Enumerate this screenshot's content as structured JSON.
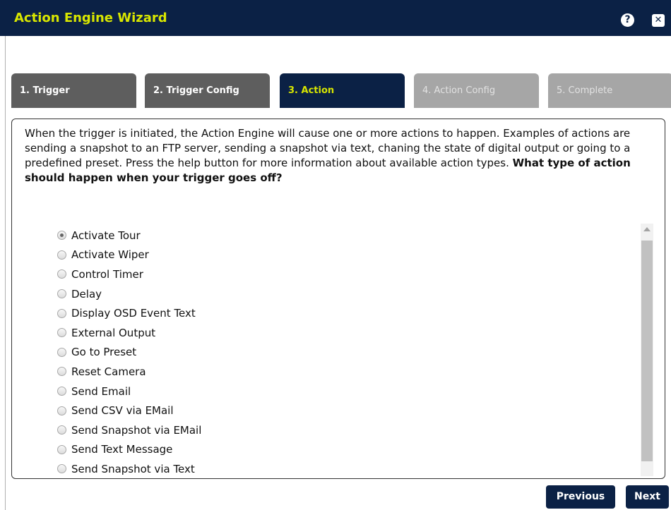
{
  "window": {
    "title": "Action Engine Wizard",
    "help_icon_glyph": "?",
    "close_icon_glyph": "✕",
    "colors": {
      "header_bg": "#0b2145",
      "title_text": "#d8e600",
      "tab_inactive": "#5e5e5e",
      "tab_disabled": "#a6a6a6"
    }
  },
  "tabs": [
    {
      "label": "1. Trigger",
      "state": "completed"
    },
    {
      "label": "2. Trigger Config",
      "state": "completed"
    },
    {
      "label": "3. Action",
      "state": "active"
    },
    {
      "label": "4. Action Config",
      "state": "disabled"
    },
    {
      "label": "5. Complete",
      "state": "disabled"
    }
  ],
  "instructions": {
    "text": "When the trigger is initiated, the Action Engine will cause one or more actions to happen. Examples of actions are sending a snapshot to an FTP server, sending a snapshot via text, chaning the state of digital output or going to a predefined preset. Press the help button for more information about available action types. ",
    "question": "What type of action should happen when your trigger goes off?"
  },
  "actions": {
    "selected": "Activate Tour",
    "options": [
      "Activate Tour",
      "Activate Wiper",
      "Control Timer",
      "Delay",
      "Display OSD Event Text",
      "External Output",
      "Go to Preset",
      "Reset Camera",
      "Send Email",
      "Send CSV via EMail",
      "Send Snapshot via EMail",
      "Send Text Message",
      "Send Snapshot via Text"
    ]
  },
  "footer": {
    "previous_label": "Previous",
    "next_label": "Next"
  }
}
